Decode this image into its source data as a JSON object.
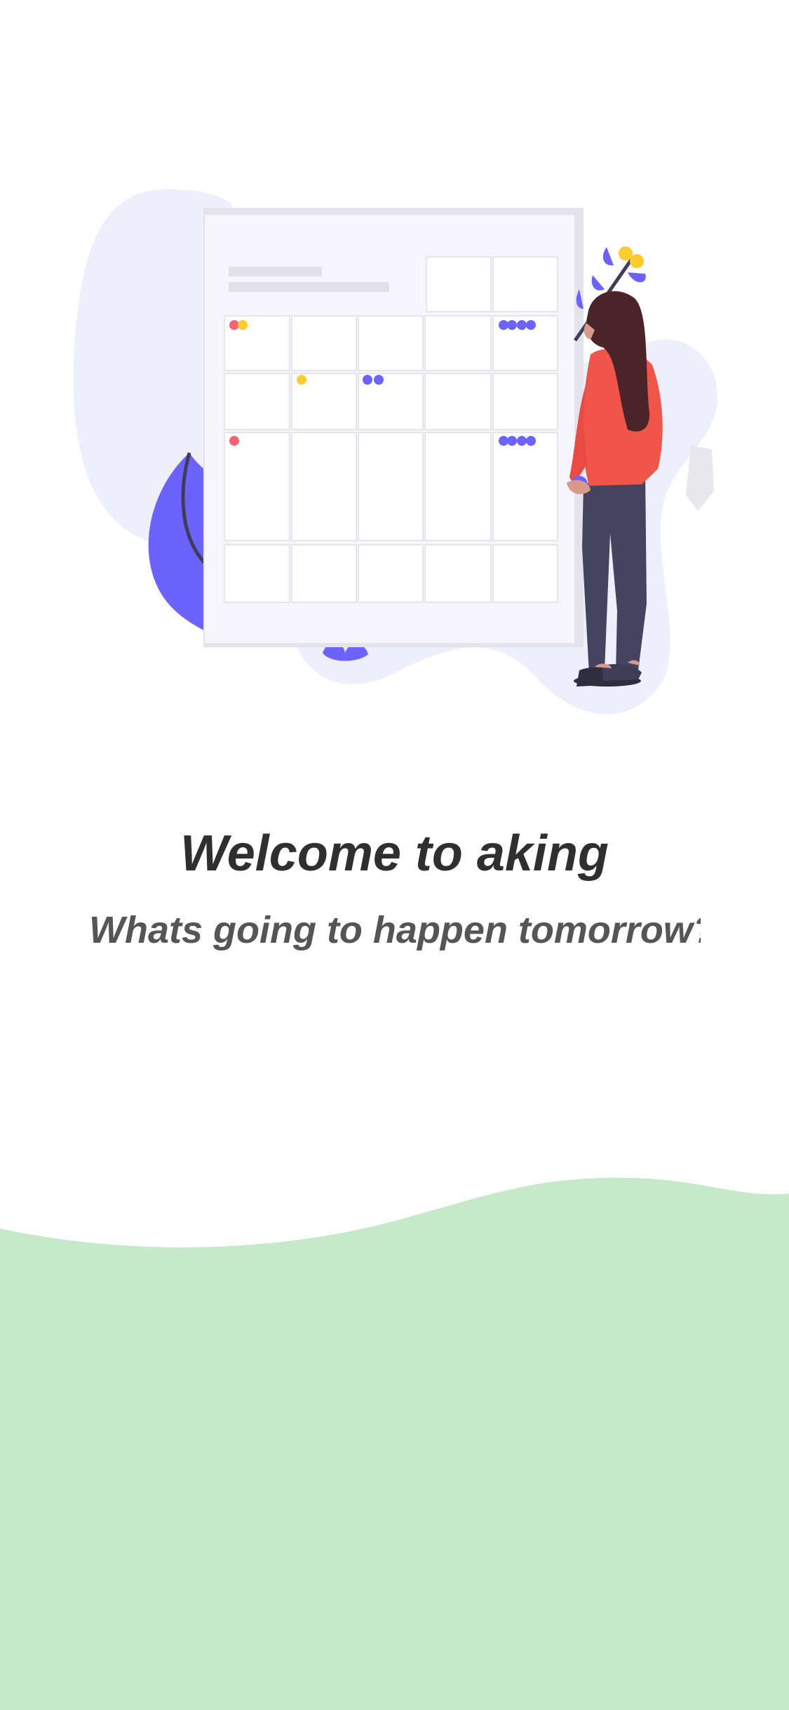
{
  "welcome": {
    "title": "Welcome to aking",
    "subtitle": "Whats going to happen tomorrow?"
  },
  "colors": {
    "accent": "#6c63ff",
    "blob": "#efeefd",
    "wave": "#c5e9c9",
    "dot_red": "#f56476",
    "dot_yellow": "#fbcc2d",
    "dress": "#f0554a",
    "hair": "#4a2428",
    "pants": "#454360"
  }
}
